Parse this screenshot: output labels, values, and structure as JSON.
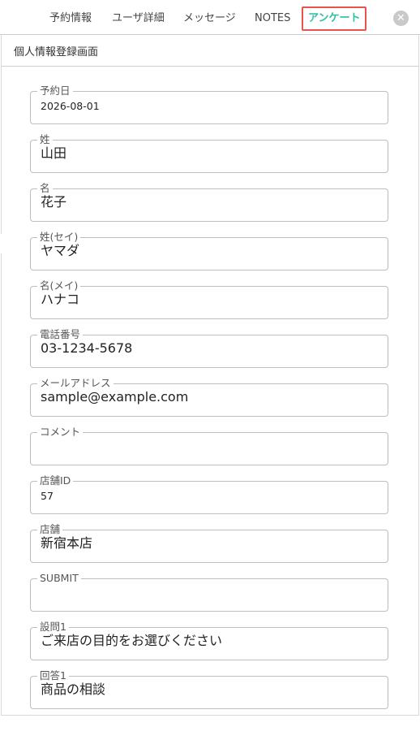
{
  "tabs": [
    {
      "label": "予約情報"
    },
    {
      "label": "ユーザ詳細"
    },
    {
      "label": "メッセージ"
    },
    {
      "label": "NOTES"
    },
    {
      "label": "アンケート",
      "active": true
    }
  ],
  "close_icon": "close-icon",
  "panel": {
    "title": "個人情報登録画面"
  },
  "fields": [
    {
      "label": "予約日",
      "value": "2026-08-01"
    },
    {
      "label": "姓",
      "value": "山田"
    },
    {
      "label": "名",
      "value": "花子"
    },
    {
      "label": "姓(セイ)",
      "value": "ヤマダ"
    },
    {
      "label": "名(メイ)",
      "value": "ハナコ"
    },
    {
      "label": "電話番号",
      "value": "03-1234-5678"
    },
    {
      "label": "メールアドレス",
      "value": "sample@example.com"
    },
    {
      "label": "コメント",
      "value": ""
    },
    {
      "label": "店舗ID",
      "value": "57"
    },
    {
      "label": "店舗",
      "value": "新宿本店"
    },
    {
      "label": "SUBMIT",
      "value": ""
    },
    {
      "label": "設問1",
      "value": "ご来店の目的をお選びください"
    },
    {
      "label": "回答1",
      "value": "商品の相談"
    }
  ],
  "colors": {
    "active_tab": "#2bbfa6",
    "active_tab_border": "#e8534f"
  }
}
